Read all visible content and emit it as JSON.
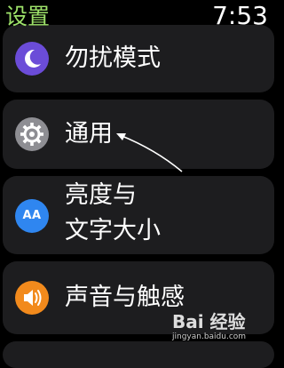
{
  "header": {
    "title": "设置",
    "time": "7:53"
  },
  "settings": {
    "items": [
      {
        "label": "勿扰模式",
        "icon": "moon-icon",
        "color": "#6b4cd8"
      },
      {
        "label": "通用",
        "icon": "gear-icon",
        "color": "#8e8e93"
      },
      {
        "label": "亮度与文字大小",
        "line1": "亮度与",
        "line2": "文字大小",
        "icon": "text-size-icon",
        "icon_text": "AA",
        "color": "#2f86f0"
      },
      {
        "label": "声音与触感",
        "icon": "speaker-icon",
        "color": "#f28a1c"
      }
    ]
  },
  "colors": {
    "title": "#9ee26a",
    "background": "#000000",
    "row": "#1d1d1f"
  },
  "watermark": {
    "logo": "Bai 经验",
    "url": "jingyan.baidu.com"
  }
}
